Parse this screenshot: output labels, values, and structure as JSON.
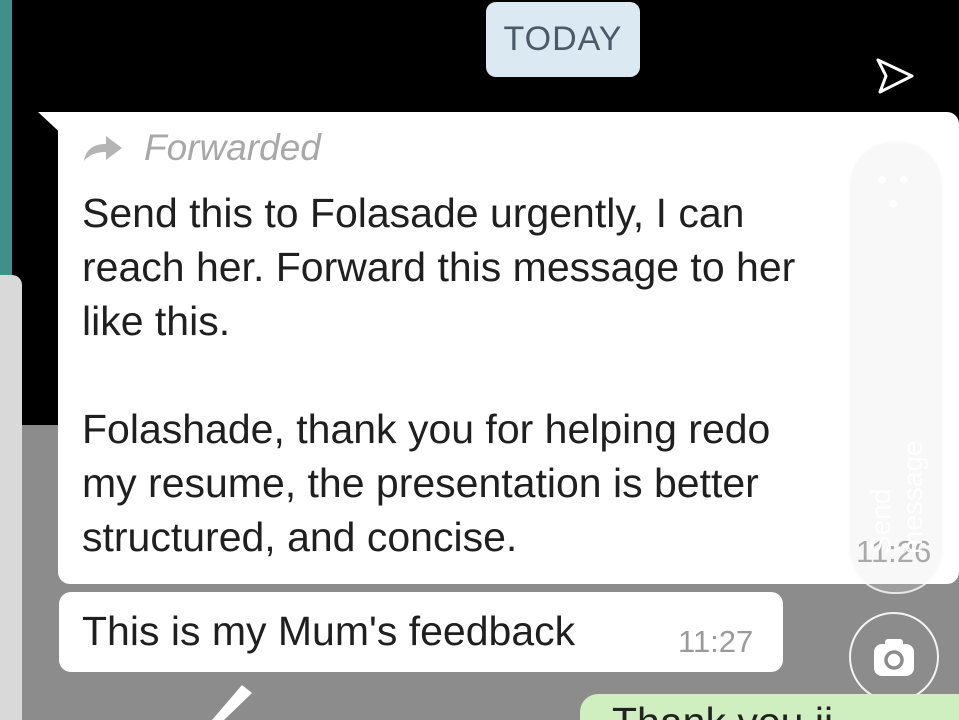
{
  "date_chip": "TODAY",
  "message_1": {
    "forwarded_label": "Forwarded",
    "text": "Send this to Folasade urgently, I can\nreach her. Forward this message to her\nlike this.\n\nFolashade, thank you for helping redo\nmy resume, the presentation is better\nstructured, and concise.",
    "time": "11:26"
  },
  "message_2": {
    "text": "This is my Mum's feedback",
    "time": "11:27"
  },
  "side_panel": {
    "menu_dots": "• • •",
    "send_label": "Send message"
  },
  "partial_outgoing_text": "Thank you ji",
  "icons": {
    "share": "share-send-icon",
    "forwarded": "forward-arrow-icon",
    "camera": "camera-icon",
    "pencil": "pencil-icon"
  },
  "colors": {
    "date_chip_bg": "#dbe9f2",
    "incoming_bubble": "#ffffff",
    "outgoing_bubble": "#cfefc0",
    "accent_strip": "#3f8f8a"
  }
}
